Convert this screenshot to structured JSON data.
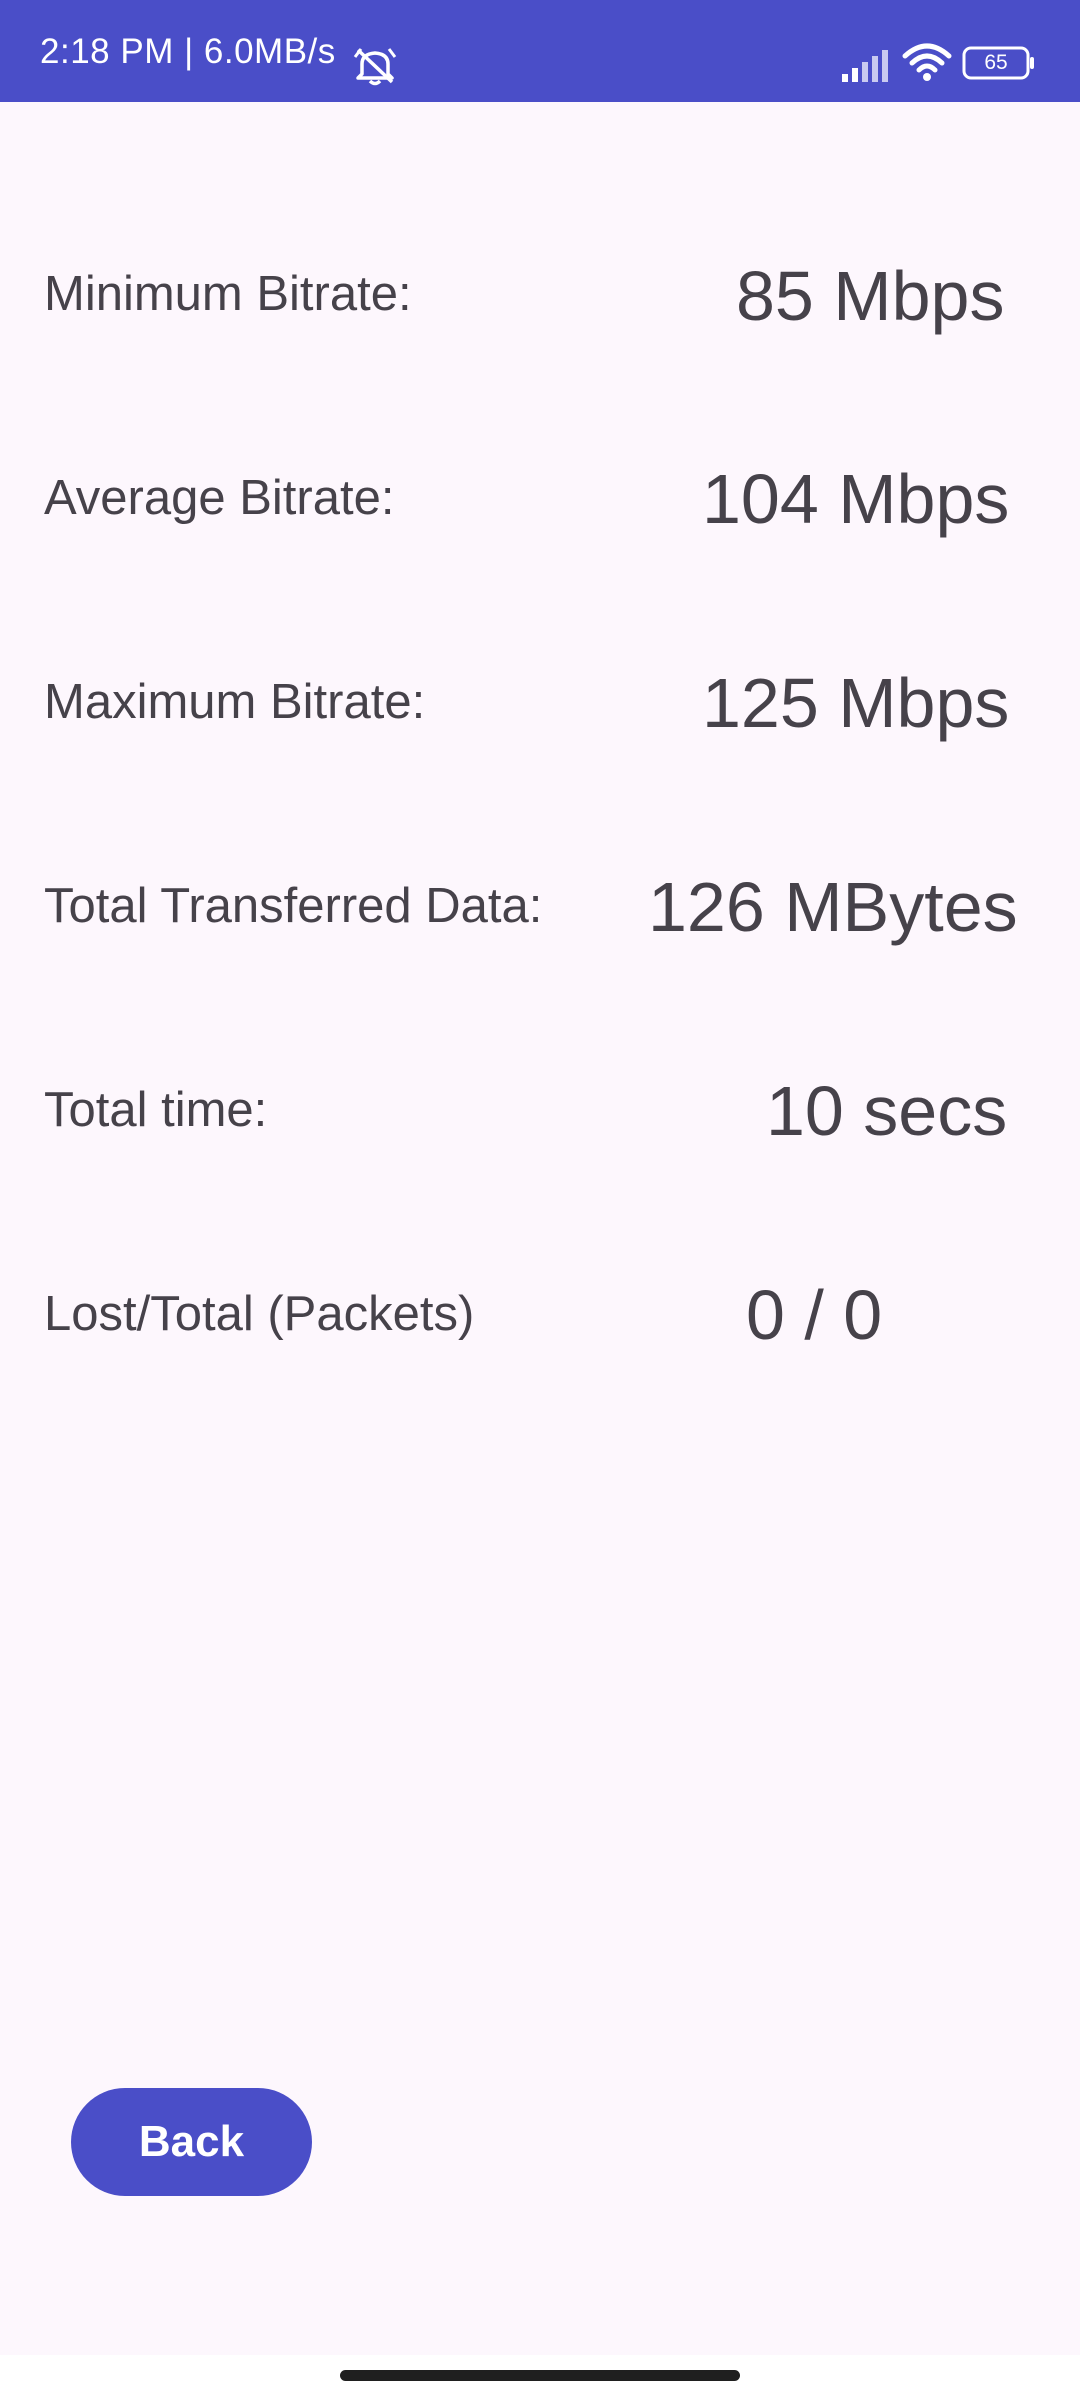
{
  "status_bar": {
    "time_speed": "2:18 PM | 6.0MB/s",
    "battery_level": "65",
    "icons": [
      "alarm-off-icon",
      "signal-icon",
      "wifi-icon",
      "battery-icon"
    ]
  },
  "stats": [
    {
      "label": "Minimum Bitrate:",
      "value": "85 Mbps"
    },
    {
      "label": "Average Bitrate:",
      "value": "104 Mbps"
    },
    {
      "label": "Maximum Bitrate:",
      "value": "125 Mbps"
    },
    {
      "label": "Total Transferred Data:",
      "value": "126 MBytes"
    },
    {
      "label": "Total time:",
      "value": "10 secs"
    },
    {
      "label": "Lost/Total (Packets)",
      "value": "0 / 0"
    }
  ],
  "back_button": {
    "label": "Back"
  },
  "colors": {
    "accent": "#4a4ec8",
    "background": "#fdf7fd",
    "text": "#46424a"
  }
}
